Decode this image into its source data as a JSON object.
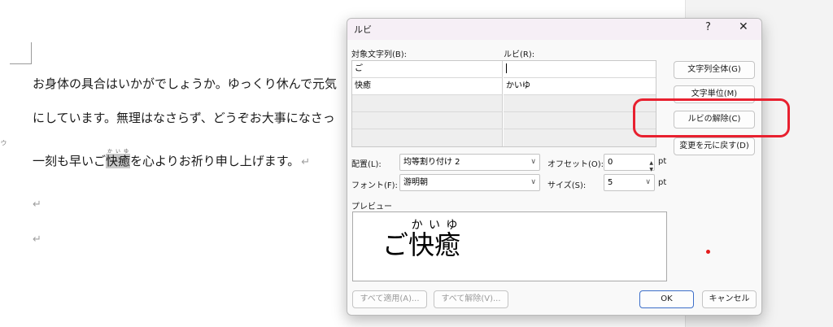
{
  "document": {
    "line1": "お身体の具合はいかがでしょうか。ゆっくり休んで元気",
    "line2": "にしています。無理はなさらず、どうぞお大事になさっ",
    "line3_before": "一刻も早いご",
    "line3_base": "快癒",
    "line3_ruby": "かいゆ",
    "line3_after": "を心よりお祈り申し上げます。",
    "para_mark": "↵",
    "margin_mark": "ゥ"
  },
  "dialog": {
    "title": "ルビ",
    "help": "?",
    "close": "✕",
    "base_header": "対象文字列(B):",
    "ruby_header": "ルビ(R):",
    "rows": [
      {
        "base": "ご",
        "ruby": ""
      },
      {
        "base": "快癒",
        "ruby": "かいゆ"
      }
    ],
    "buttons": {
      "whole_string": "文字列全体(G)",
      "per_char": "文字単位(M)",
      "remove_ruby": "ルビの解除(C)",
      "reset": "変更を元に戻す(D)",
      "apply_all": "すべて適用(A)...",
      "remove_all": "すべて解除(V)...",
      "ok": "OK",
      "cancel": "キャンセル"
    },
    "alignment_label": "配置(L):",
    "alignment_value": "均等割り付け 2",
    "offset_label": "オフセット(O):",
    "offset_value": "0",
    "font_label": "フォント(F):",
    "font_value": "游明朝",
    "size_label": "サイズ(S):",
    "size_value": "5",
    "unit": "pt",
    "preview_label": "プレビュー",
    "preview_before": "ご",
    "preview_base": "快癒",
    "preview_ruby": "かいゆ"
  },
  "colors": {
    "annotation_red": "#e8202f",
    "ok_border": "#3c6ec9"
  }
}
